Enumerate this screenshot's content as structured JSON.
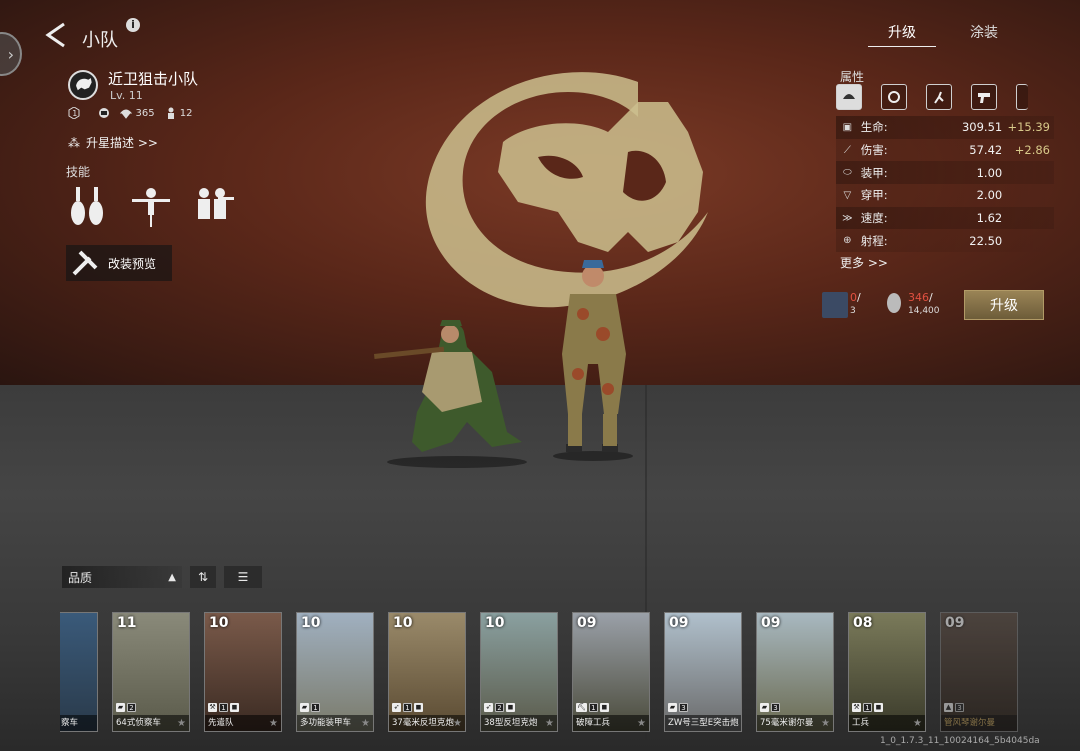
{
  "header": {
    "title": "小队",
    "info": "i"
  },
  "squad": {
    "name": "近卫狙击小队",
    "level": "Lv. 11",
    "stats": {
      "rank": "1",
      "bullets": "365",
      "men": "12"
    },
    "star_desc": "升星描述 >>",
    "skills_label": "技能",
    "mod_preview": "改装预览"
  },
  "tabs": [
    {
      "label": "升级"
    },
    {
      "label": "涂装"
    }
  ],
  "attributes": {
    "label": "属性",
    "icons": [
      "helmet-icon",
      "target-gear-icon",
      "runner-icon",
      "pistol-icon",
      "bullet-icon"
    ],
    "rows": [
      {
        "icon": "health-icon",
        "name": "生命:",
        "value": "309.51",
        "bonus": "+15.39"
      },
      {
        "icon": "damage-icon",
        "name": "伤害:",
        "value": "57.42",
        "bonus": "+2.86"
      },
      {
        "icon": "armor-icon",
        "name": "装甲:",
        "value": "1.00",
        "bonus": ""
      },
      {
        "icon": "penetration-icon",
        "name": "穿甲:",
        "value": "2.00",
        "bonus": ""
      },
      {
        "icon": "speed-icon",
        "name": "速度:",
        "value": "1.62",
        "bonus": ""
      },
      {
        "icon": "range-icon",
        "name": "射程:",
        "value": "22.50",
        "bonus": ""
      }
    ],
    "more": "更多 >>"
  },
  "cost": {
    "item1": {
      "have": "0",
      "sep": "/",
      "need": "3"
    },
    "item2": {
      "have": "346",
      "sep": "/",
      "need": "14,400"
    },
    "upgrade_label": "升级"
  },
  "filter": {
    "sort_label": "品质",
    "sort_arrow": "▲"
  },
  "cards": [
    {
      "level": "",
      "name": "察车",
      "badges": [],
      "color": "#3a5a7a"
    },
    {
      "level": "11",
      "name": "64式侦察车",
      "badges": [
        "2",
        "■"
      ],
      "color": "#6b6b5a"
    },
    {
      "level": "10",
      "name": "先遣队",
      "badges": [
        "1",
        "■"
      ],
      "color": "#5a4a3a"
    },
    {
      "level": "10",
      "name": "多功能装甲车",
      "badges": [
        "1"
      ],
      "color": "#8a8a7a"
    },
    {
      "level": "10",
      "name": "37毫米反坦克炮",
      "badges": [
        "1",
        "■"
      ],
      "color": "#7a6a4a"
    },
    {
      "level": "10",
      "name": "38型反坦克炮",
      "badges": [
        "2",
        "■"
      ],
      "color": "#6a6a5a"
    },
    {
      "level": "09",
      "name": "破障工兵",
      "badges": [
        "1",
        "■"
      ],
      "color": "#5a5a4a"
    },
    {
      "level": "09",
      "name": "ZW号三型E突击炮",
      "badges": [
        "3"
      ],
      "color": "#8a9aa0"
    },
    {
      "level": "09",
      "name": "75毫米谢尔曼",
      "badges": [
        "3"
      ],
      "color": "#7a8a6a"
    },
    {
      "level": "08",
      "name": "工兵",
      "badges": [
        "1",
        "■"
      ],
      "color": "#5a5a4a"
    },
    {
      "level": "09",
      "name": "管风琴谢尔曼",
      "badges": [
        "3"
      ],
      "color": "#4a3a30"
    }
  ],
  "version": "1_0_1.7.3_11_10024164_5b4045da"
}
